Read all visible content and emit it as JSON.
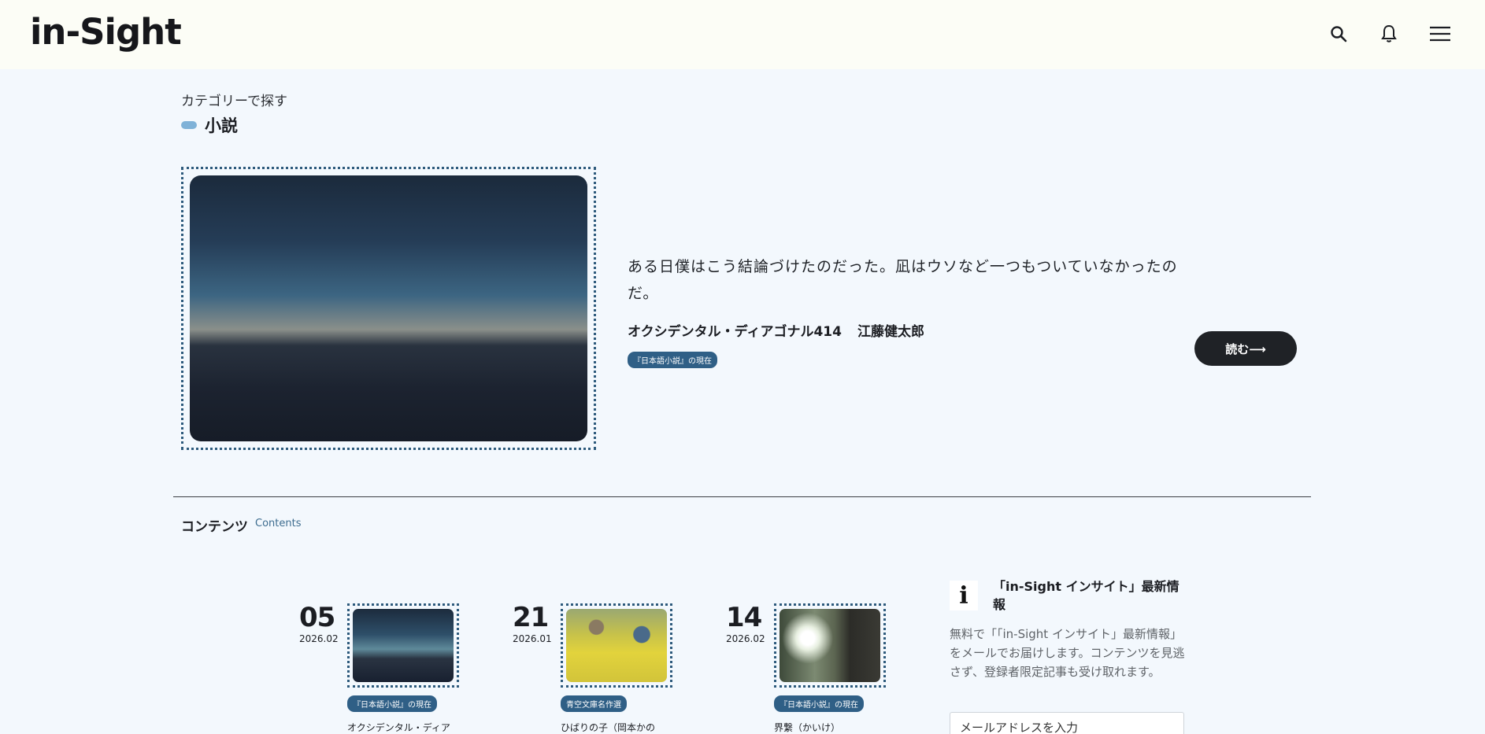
{
  "header": {
    "logo": "in-Sight",
    "icons": [
      "search-icon",
      "bell-icon",
      "menu-icon"
    ]
  },
  "category": {
    "label": "カテゴリーで探す",
    "title": "小説"
  },
  "featured": {
    "quote": "ある日僕はこう結論づけたのだった。凪はウソなど一つもついていなかったのだ。",
    "work_title": "オクシデンタル・ディアゴナル414",
    "author": "江藤健太郎",
    "tag": "『日本語小説』の現在",
    "read_button": "読む⟶"
  },
  "contents": {
    "title": "コンテンツ",
    "subtitle": "Contents",
    "cards": [
      {
        "day": "05",
        "year_month": "2026.02",
        "tag": "『日本語小説』の現在",
        "title": "オクシデンタル・ディア"
      },
      {
        "day": "21",
        "year_month": "2026.01",
        "tag": "青空文庫名作選",
        "title": "ひばりの子（岡本かの"
      },
      {
        "day": "14",
        "year_month": "2026.02",
        "tag": "『日本語小説』の現在",
        "title": "界繋（かいけ）"
      }
    ]
  },
  "newsletter": {
    "icon_letter": "i",
    "title": "「in-Sight インサイト」最新情報",
    "description": "無料で「「in-Sight インサイト」最新情報」をメールでお届けします。コンテンツを見逃さず、登録者限定記事も受け取れます。",
    "email_placeholder": "メールアドレスを入力"
  },
  "colors": {
    "background": "#f3f8fd",
    "header_bg": "#fcfdf6",
    "accent": "#2f5f86",
    "pill": "#7fb2d8",
    "button": "#1f2226"
  }
}
